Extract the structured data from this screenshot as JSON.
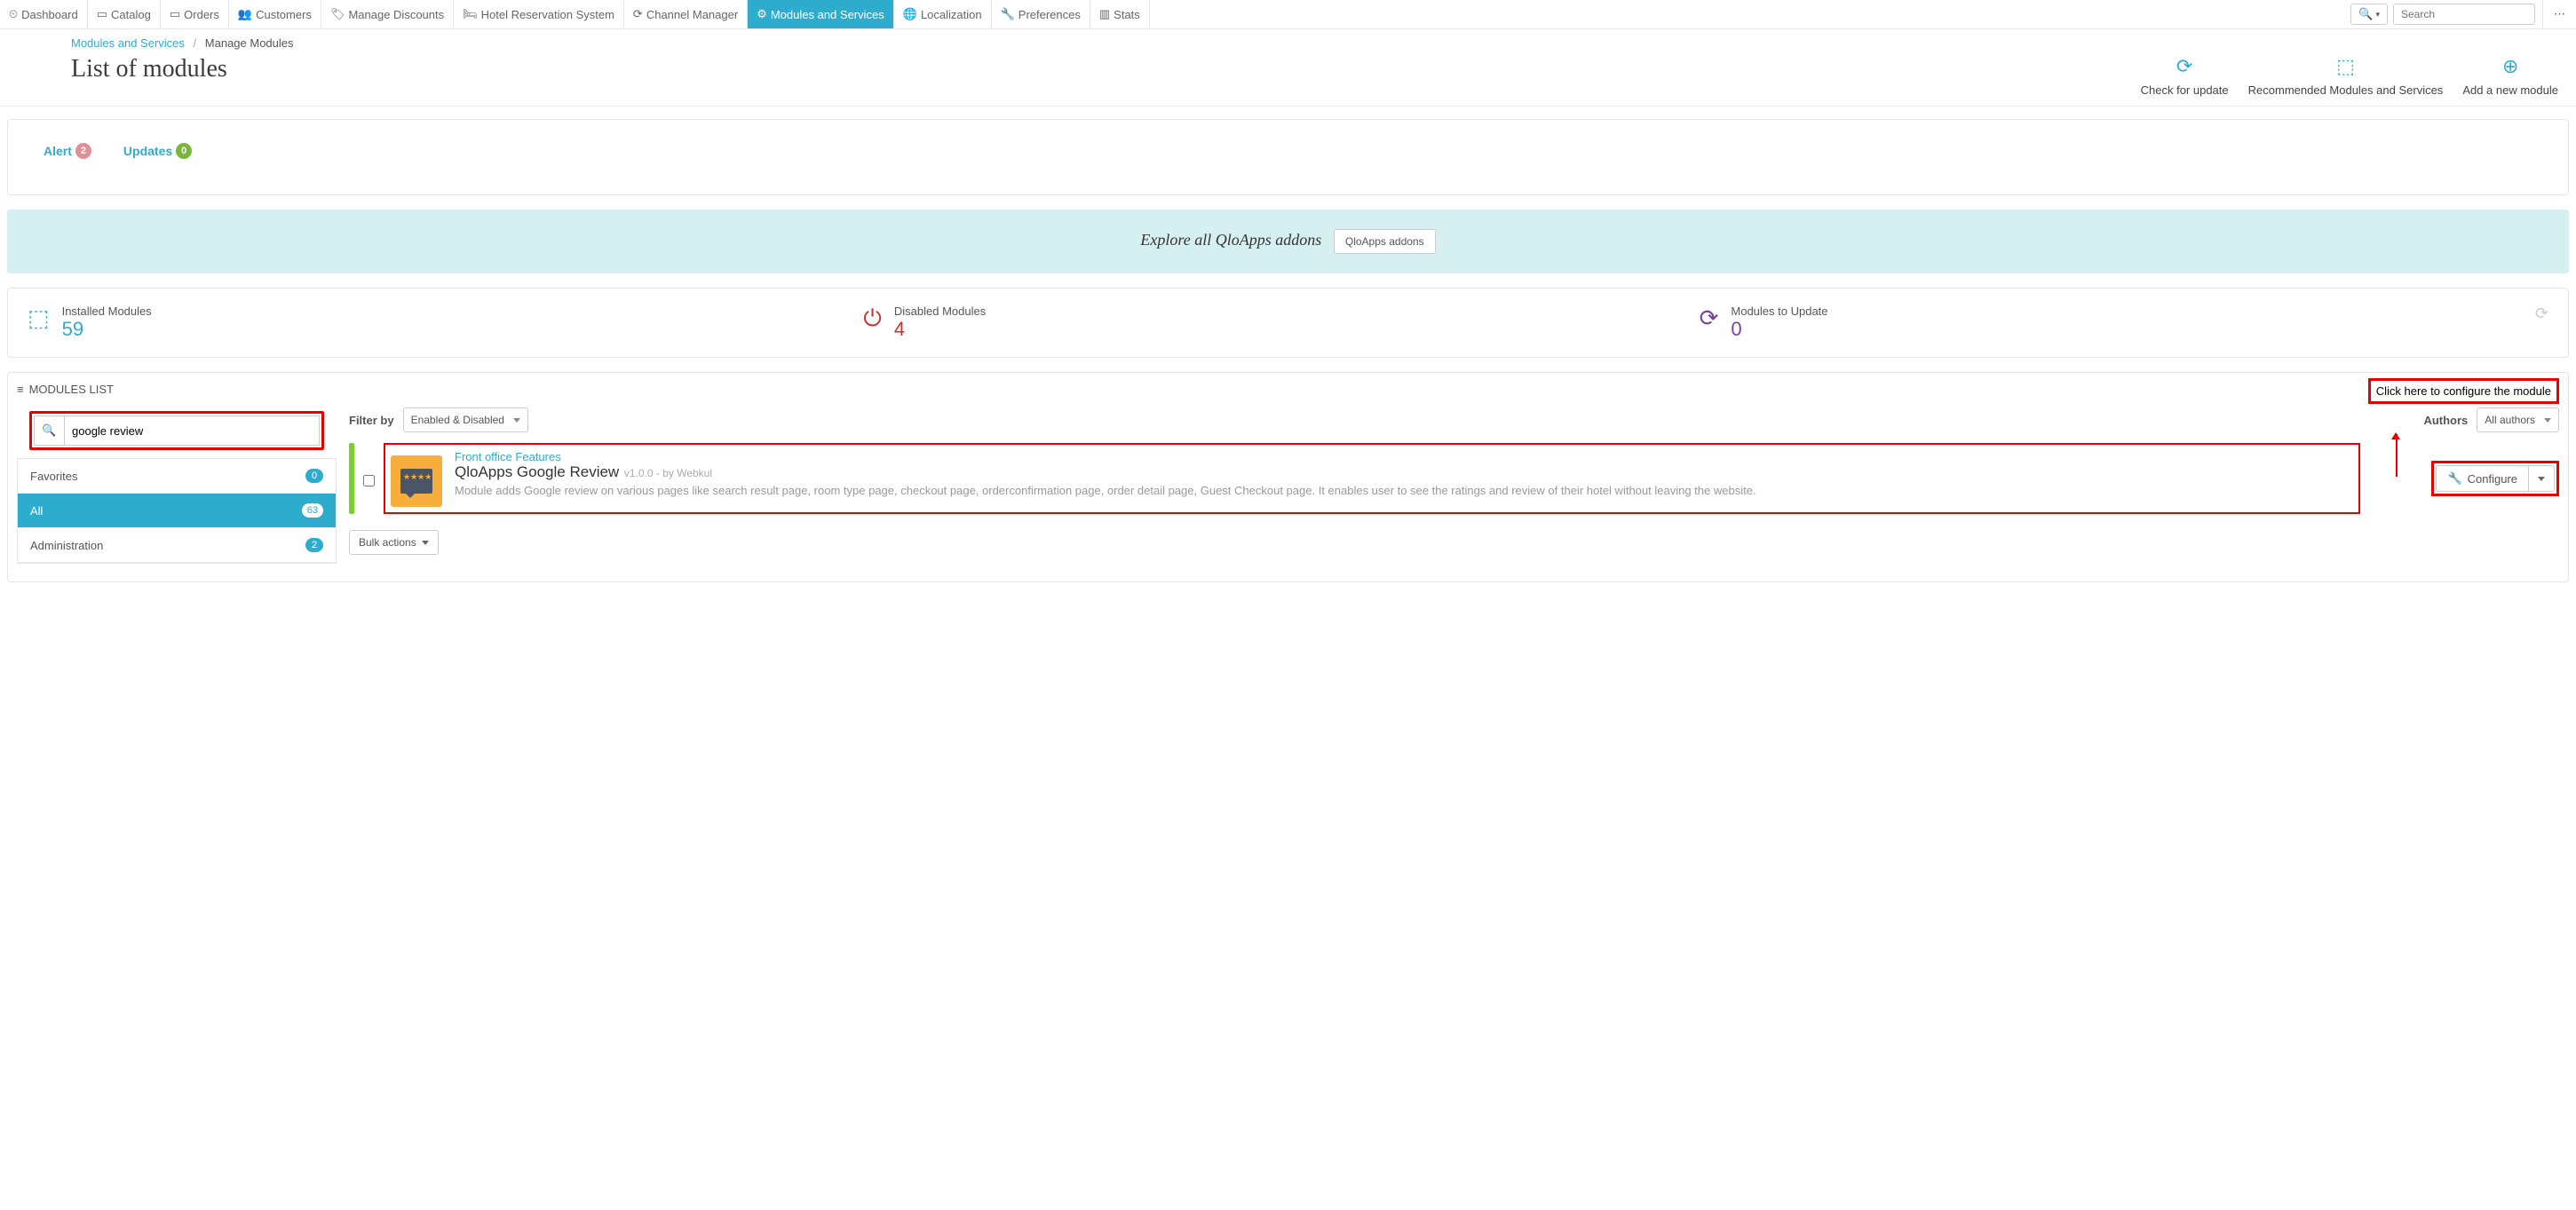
{
  "topnav": {
    "items": [
      {
        "label": "Dashboard"
      },
      {
        "label": "Catalog"
      },
      {
        "label": "Orders"
      },
      {
        "label": "Customers"
      },
      {
        "label": "Manage Discounts"
      },
      {
        "label": "Hotel Reservation System"
      },
      {
        "label": "Channel Manager"
      },
      {
        "label": "Modules and Services"
      },
      {
        "label": "Localization"
      },
      {
        "label": "Preferences"
      },
      {
        "label": "Stats"
      }
    ],
    "search_placeholder": "Search"
  },
  "breadcrumb": {
    "a": "Modules and Services",
    "b": "Manage Modules"
  },
  "page_title": "List of modules",
  "actions": {
    "check": "Check for update",
    "rec": "Recommended Modules and Services",
    "add": "Add a new module"
  },
  "tabs": {
    "alert": "Alert",
    "alert_n": "2",
    "updates": "Updates",
    "updates_n": "0"
  },
  "explore": {
    "text": "Explore all QloApps addons",
    "btn": "QloApps addons"
  },
  "stats": {
    "installed": {
      "lbl": "Installed Modules",
      "n": "59"
    },
    "disabled": {
      "lbl": "Disabled Modules",
      "n": "4"
    },
    "toupdate": {
      "lbl": "Modules to Update",
      "n": "0"
    }
  },
  "mods_header": "MODULES LIST",
  "annotation": "Click here to configure the module",
  "search_value": "google review",
  "cats": {
    "fav": {
      "lbl": "Favorites",
      "n": "0"
    },
    "all": {
      "lbl": "All",
      "n": "63"
    },
    "admin": {
      "lbl": "Administration",
      "n": "2"
    }
  },
  "filter": {
    "lbl": "Filter by",
    "sel": "Enabled & Disabled",
    "authors_lbl": "Authors",
    "authors_sel": "All authors"
  },
  "module": {
    "cat": "Front office Features",
    "name": "QloApps Google Review",
    "ver": "v1.0.0 - by Webkul",
    "desc": "Module adds Google review on various pages like search result page, room type page, checkout page, orderconfirmation page, order detail page, Guest Checkout page. It enables user to see the ratings and review of their hotel without leaving the website."
  },
  "configure": "Configure",
  "bulk": "Bulk actions"
}
